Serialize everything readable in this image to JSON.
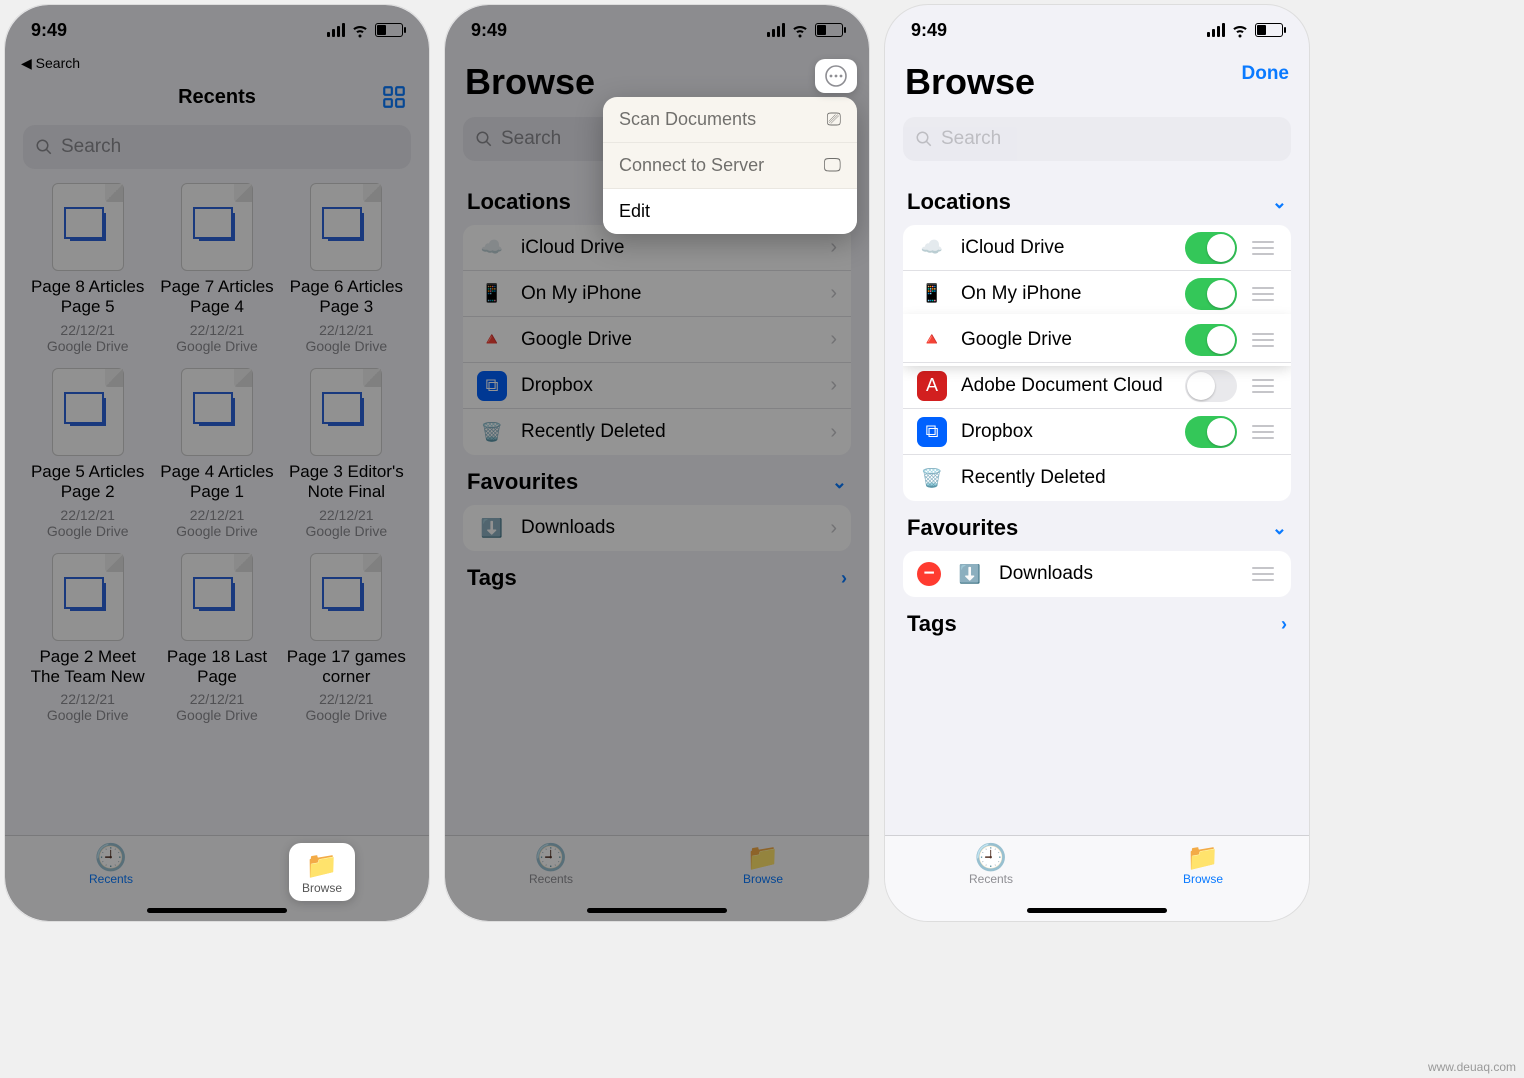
{
  "status": {
    "time": "9:49"
  },
  "screen1": {
    "back": "◀︎ Search",
    "title": "Recents",
    "search_placeholder": "Search",
    "files": [
      {
        "name": "Page 8 Articles Page 5",
        "date": "22/12/21",
        "src": "Google Drive"
      },
      {
        "name": "Page 7 Articles Page 4",
        "date": "22/12/21",
        "src": "Google Drive"
      },
      {
        "name": "Page 6 Articles Page 3",
        "date": "22/12/21",
        "src": "Google Drive"
      },
      {
        "name": "Page 5 Articles Page 2",
        "date": "22/12/21",
        "src": "Google Drive"
      },
      {
        "name": "Page 4 Articles Page 1",
        "date": "22/12/21",
        "src": "Google Drive"
      },
      {
        "name": "Page 3 Editor's Note Final",
        "date": "22/12/21",
        "src": "Google Drive"
      },
      {
        "name": "Page 2 Meet The Team New",
        "date": "22/12/21",
        "src": "Google Drive"
      },
      {
        "name": "Page 18 Last Page",
        "date": "22/12/21",
        "src": "Google Drive"
      },
      {
        "name": "Page 17 games corner",
        "date": "22/12/21",
        "src": "Google Drive"
      }
    ],
    "tabs": {
      "recents": "Recents",
      "browse": "Browse"
    }
  },
  "screen2": {
    "title": "Browse",
    "search_placeholder": "Search",
    "menu": {
      "scan": "Scan Documents",
      "connect": "Connect to Server",
      "edit": "Edit"
    },
    "sections": {
      "locations": "Locations",
      "favourites": "Favourites",
      "tags": "Tags"
    },
    "locations": [
      {
        "label": "iCloud Drive"
      },
      {
        "label": "On My iPhone"
      },
      {
        "label": "Google Drive"
      },
      {
        "label": "Dropbox"
      },
      {
        "label": "Recently Deleted"
      }
    ],
    "favourites": [
      {
        "label": "Downloads"
      }
    ],
    "tabs": {
      "recents": "Recents",
      "browse": "Browse"
    }
  },
  "screen3": {
    "title": "Browse",
    "done": "Done",
    "search_placeholder": "Search",
    "sections": {
      "locations": "Locations",
      "favourites": "Favourites",
      "tags": "Tags"
    },
    "locations": [
      {
        "label": "iCloud Drive",
        "on": true
      },
      {
        "label": "On My iPhone",
        "on": true
      },
      {
        "label": "Google Drive",
        "on": true
      },
      {
        "label": "Adobe Document Cloud",
        "on": false
      },
      {
        "label": "Dropbox",
        "on": true
      },
      {
        "label": "Recently Deleted"
      }
    ],
    "favourites": [
      {
        "label": "Downloads"
      }
    ],
    "tabs": {
      "recents": "Recents",
      "browse": "Browse"
    }
  },
  "watermark": "www.deuaq.com"
}
